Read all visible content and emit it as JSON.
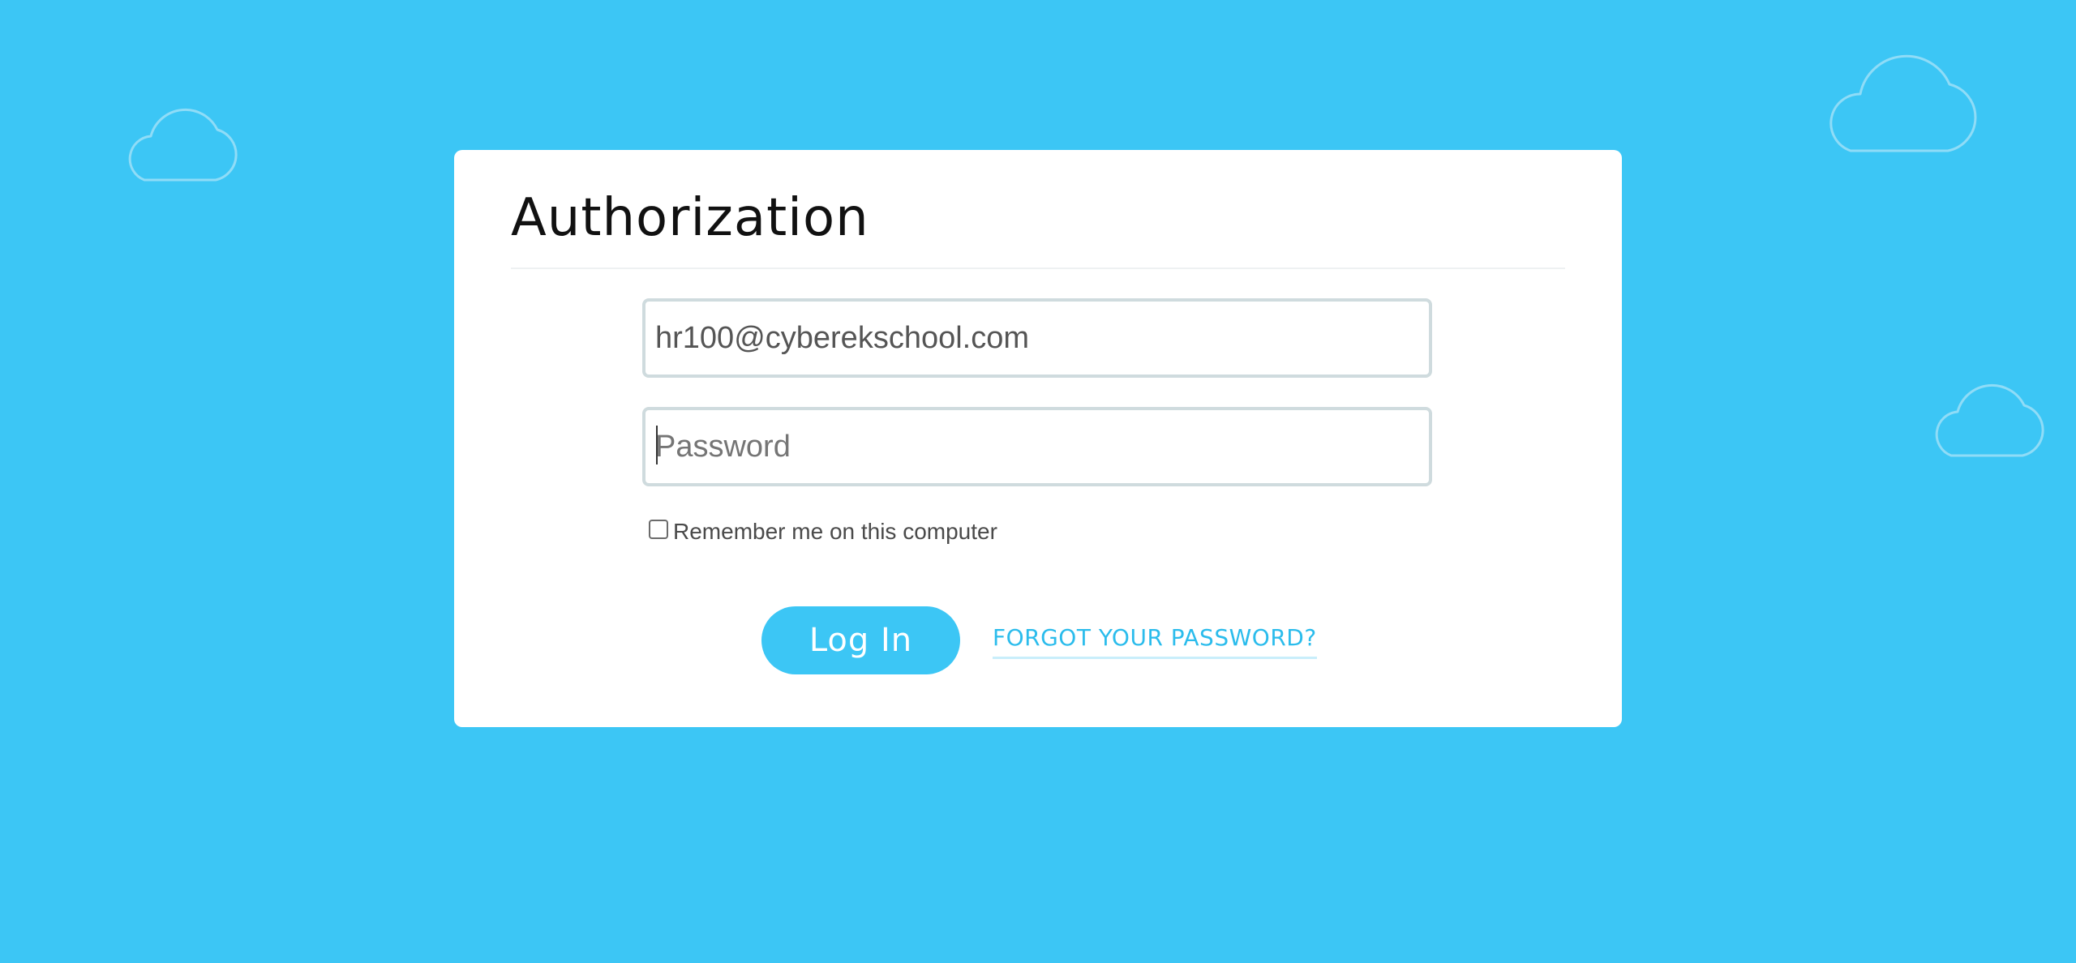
{
  "colors": {
    "background": "#3cc6f5",
    "accent": "#3cc6f5",
    "link": "#2bbcec",
    "card": "#ffffff"
  },
  "decor": {
    "clouds": [
      "cloud-icon",
      "cloud-icon",
      "cloud-icon"
    ]
  },
  "auth": {
    "title": "Authorization",
    "login_field": {
      "value": "hr100@cyberekschool.com",
      "placeholder": ""
    },
    "password_field": {
      "value": "",
      "placeholder": "Password"
    },
    "remember_label": "Remember me on this computer",
    "remember_checked": false,
    "login_button_label": "Log In",
    "forgot_link_label": "FORGOT YOUR PASSWORD?"
  }
}
